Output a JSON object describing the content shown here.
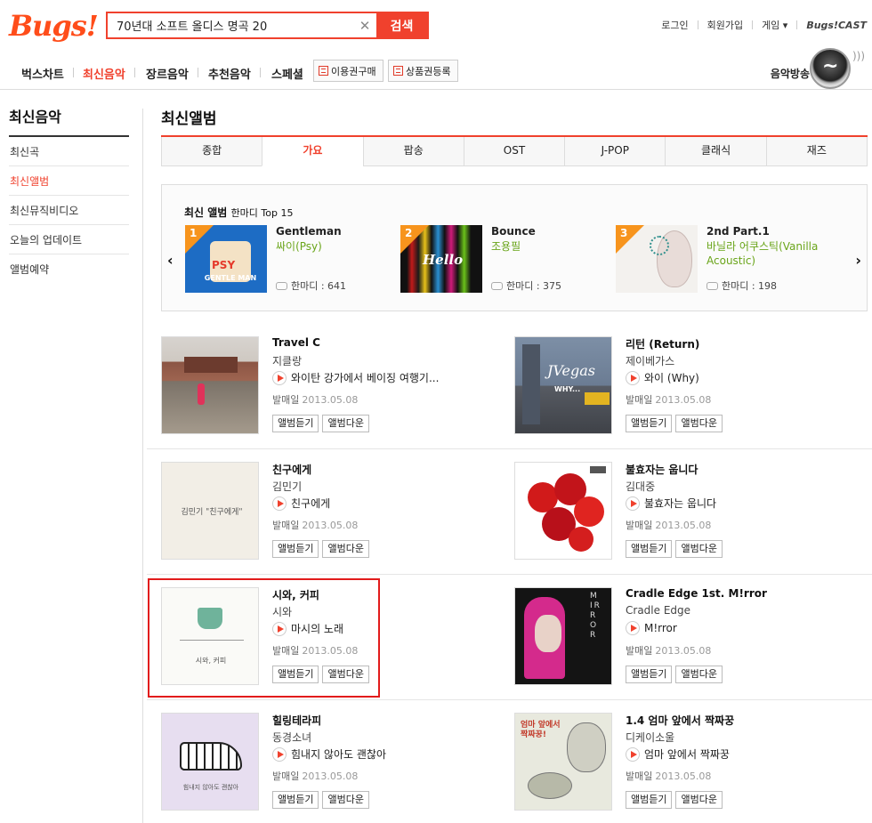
{
  "header": {
    "logo": "Bugs!",
    "search_value": "70년대 소프트 올디스 명곡 20",
    "search_button": "검색",
    "util": [
      "로그인",
      "회원가입",
      "게임 ▾"
    ],
    "cast": "Bugs!CAST"
  },
  "gnb": {
    "items": [
      "벅스차트",
      "최신음악",
      "장르음악",
      "추천음악",
      "스페셜"
    ],
    "buttons": [
      "이용권구매",
      "상품권등록"
    ],
    "radio": "음악방송"
  },
  "sidebar": {
    "title": "최신음악",
    "items": [
      "최신곡",
      "최신앨범",
      "최신뮤직비디오",
      "오늘의 업데이트",
      "앨범예약"
    ]
  },
  "main": {
    "title": "최신앨범",
    "tabs": [
      "종합",
      "가요",
      "팝송",
      "OST",
      "J-POP",
      "클래식",
      "재즈"
    ]
  },
  "top15": {
    "title": "최신 앨범",
    "subtitle": "한마디 Top 15",
    "items": [
      {
        "rank": "1",
        "name": "Gentleman",
        "artist": "싸이(Psy)",
        "comment": "한마디 : 641"
      },
      {
        "rank": "2",
        "name": "Bounce",
        "artist": "조용필",
        "comment": "한마디 : 375"
      },
      {
        "rank": "3",
        "name": "2nd Part.1",
        "artist": "바닐라 어쿠스틱(Vanilla Acoustic)",
        "comment": "한마디 : 198"
      }
    ]
  },
  "labels": {
    "release": "발매일",
    "listen": "앨범듣기",
    "download": "앨범다운"
  },
  "albums": [
    {
      "title": "Travel C",
      "artist": "지클랑",
      "track": "와이탄 강가에서 베이징 여행기...",
      "date": "2013.05.08"
    },
    {
      "title": "리턴 (Return)",
      "artist": "제이베가스",
      "track": "와이 (Why)",
      "date": "2013.05.08"
    },
    {
      "title": "친구에게",
      "artist": "김민기",
      "track": "친구에게",
      "date": "2013.05.08"
    },
    {
      "title": "불효자는 웁니다",
      "artist": "김대중",
      "track": "불효자는 웁니다",
      "date": "2013.05.08"
    },
    {
      "title": "시와, 커피",
      "artist": "시와",
      "track": "마시의 노래",
      "date": "2013.05.08"
    },
    {
      "title": "Cradle Edge 1st. M!rror",
      "artist": "Cradle Edge",
      "track": "M!rror",
      "date": "2013.05.08"
    },
    {
      "title": "힐링테라피",
      "artist": "동경소녀",
      "track": "힘내지 않아도 괜찮아",
      "date": "2013.05.08"
    },
    {
      "title": "1.4 엄마 앞에서 짝짜꿍",
      "artist": "디케이소울",
      "track": "엄마 앞에서 짝짜꿍",
      "date": "2013.05.08"
    }
  ],
  "cover_text": {
    "psy": "PSY",
    "psy_sub": "GENTLE MAN",
    "bounce": "Hello",
    "jvegas": "JVegas",
    "jvegas_sub": "WHY...",
    "kimminki": "김민기 \"친구에게\"",
    "siwa": "시와, 커피",
    "mirror": "MIRROR",
    "healing": "힘내지 않아도 괜찮아",
    "mom": "엄마 앞에서 짝짜꿍!"
  }
}
